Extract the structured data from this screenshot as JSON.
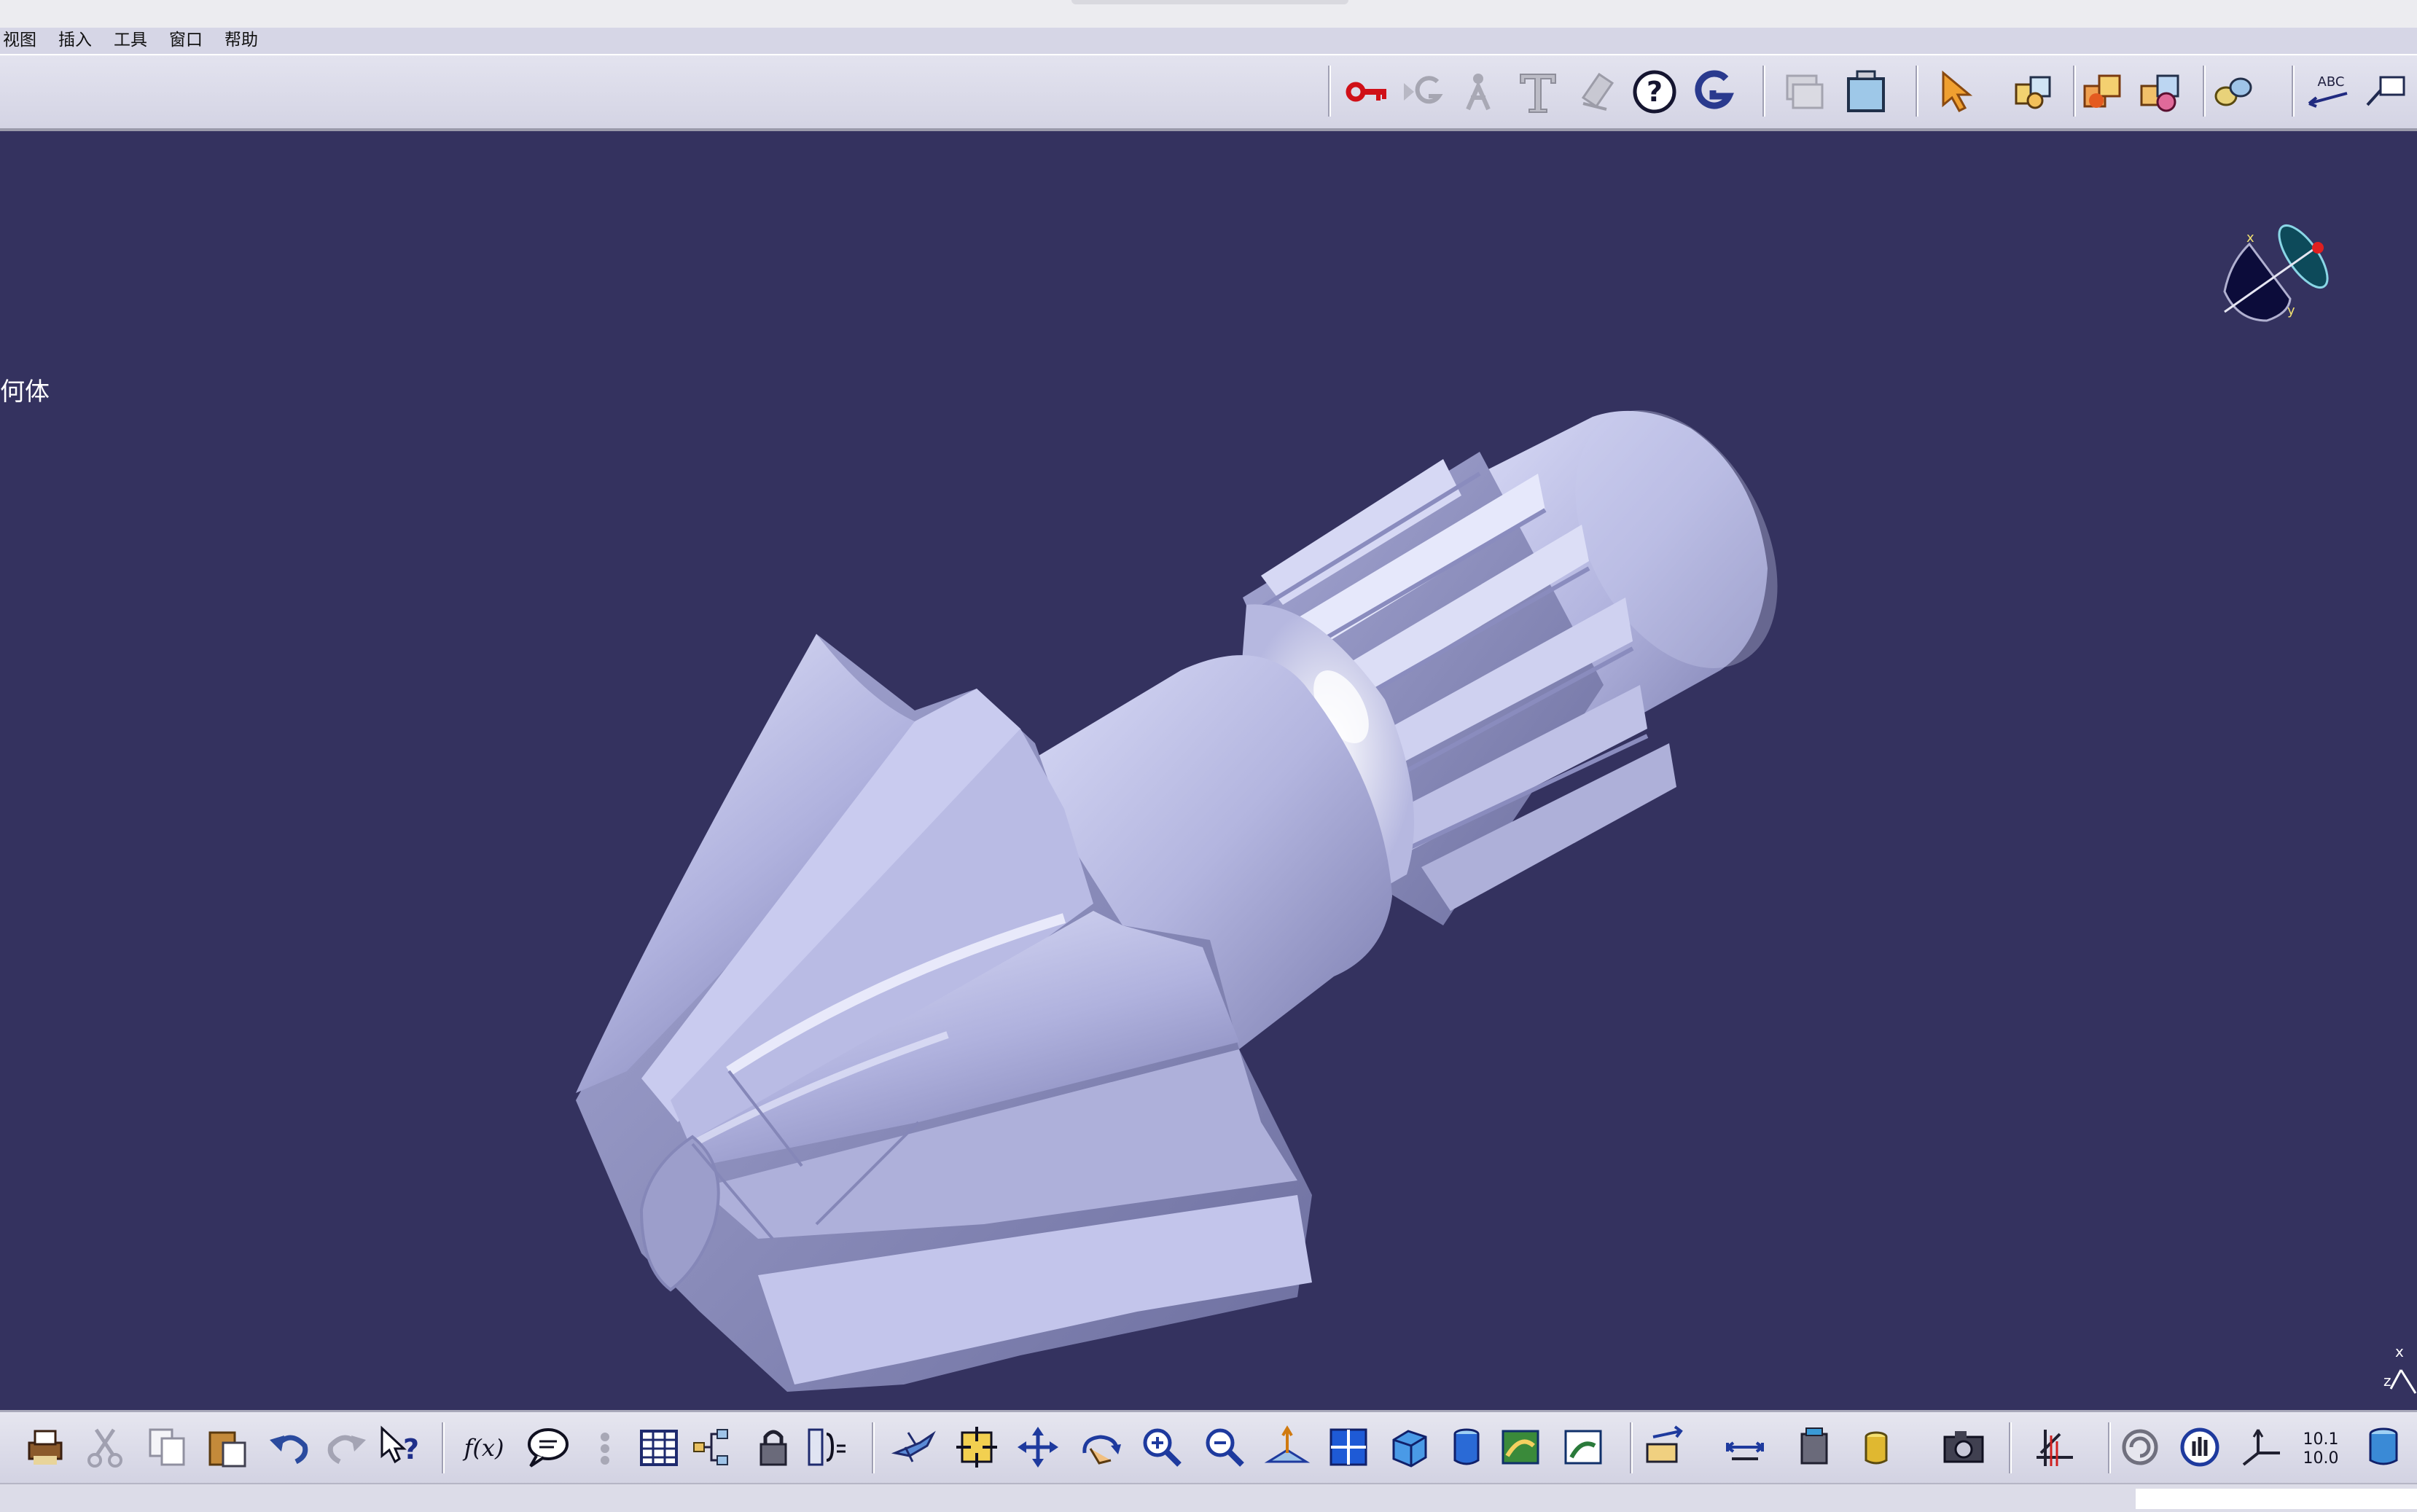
{
  "menubar": {
    "items": [
      {
        "label": "视图"
      },
      {
        "label": "插入"
      },
      {
        "label": "工具"
      },
      {
        "label": "窗口"
      },
      {
        "label": "帮助"
      }
    ]
  },
  "tree": {
    "fragment_label": "何体"
  },
  "toolbar_top": {
    "icons": [
      "key-icon",
      "grayed-g-icon",
      "grayed-person-icon",
      "text-icon",
      "grayed-stamp-icon",
      "help-icon",
      "g-logo-icon",
      "grayed-window-icon",
      "frame-icon",
      "select-arrow-icon",
      "product-icon",
      "component-icon",
      "multi-component-icon",
      "link-icon",
      "abc-annotation-icon",
      "leader-icon"
    ]
  },
  "toolbar_bottom": {
    "icons": [
      "print-icon",
      "cut-icon",
      "copy-icon",
      "paste-icon",
      "undo-icon",
      "redo-icon",
      "whats-this-icon",
      "formula-icon",
      "comment-icon",
      "grayed-knowledge-icon",
      "table-icon",
      "tree-icon",
      "lock-icon",
      "parameters-icon",
      "fly-icon",
      "fit-all-icon",
      "pan-icon",
      "rotate-icon",
      "zoom-in-icon",
      "zoom-out-icon",
      "normal-view-icon",
      "multi-view-icon",
      "iso-view-icon",
      "shading-icon",
      "hide-show-icon",
      "swap-space-icon",
      "measure-icon",
      "measure-item-icon",
      "inertia-icon",
      "weight-icon",
      "capture-icon",
      "axis-system-icon",
      "refresh-icon",
      "manipulation-icon",
      "axis-icon",
      "scale-icon",
      "cylinder-icon"
    ]
  },
  "compass": {
    "x_label": "x",
    "y_label": "y"
  },
  "axis_triad": {
    "x_label": "x",
    "z_label": "z"
  },
  "colors": {
    "viewport_bg": "#34325f",
    "part_light": "#c9cbee",
    "part_mid": "#a8aad6",
    "part_dark": "#7d7fb0"
  }
}
